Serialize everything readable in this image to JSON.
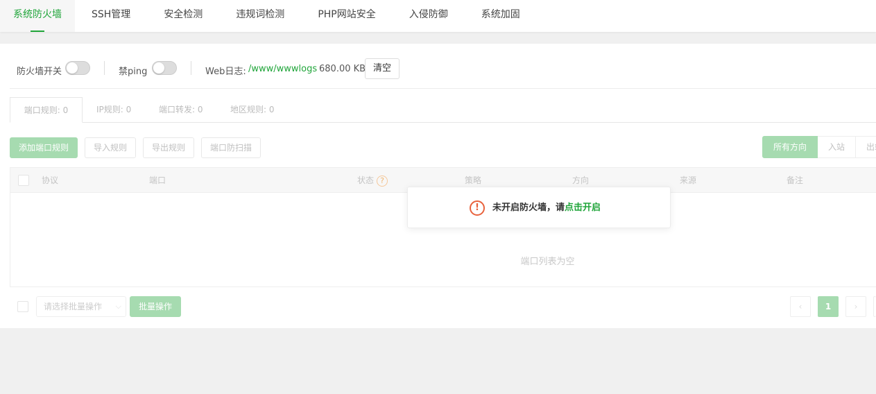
{
  "nav": {
    "tabs": [
      {
        "label": "系统防火墙"
      },
      {
        "label": "SSH管理"
      },
      {
        "label": "安全检测"
      },
      {
        "label": "违规词检测"
      },
      {
        "label": "PHP网站安全"
      },
      {
        "label": "入侵防御"
      },
      {
        "label": "系统加固"
      }
    ]
  },
  "toolbar": {
    "firewall_label": "防火墙开关",
    "ping_label": "禁ping",
    "weblog_label": "Web日志:",
    "weblog_path": "/www/wwwlogs",
    "weblog_size": "680.00 KB",
    "clear_label": "清空"
  },
  "subtabs": [
    {
      "label": "端口规则: 0"
    },
    {
      "label": "IP规则: 0"
    },
    {
      "label": "端口转发: 0"
    },
    {
      "label": "地区规则: 0"
    }
  ],
  "buttons": {
    "add_port_rule": "添加端口规则",
    "import_rules": "导入规则",
    "export_rules": "导出规则",
    "port_scan_protect": "端口防扫描"
  },
  "direction_filter": {
    "all": "所有方向",
    "inbound": "入站",
    "outbound": "出站"
  },
  "table": {
    "columns": {
      "protocol": "协议",
      "port": "端口",
      "status": "状态",
      "strategy": "策略",
      "direction": "方向",
      "source": "来源",
      "remark": "备注"
    },
    "empty_text": "端口列表为空"
  },
  "bottom": {
    "batch_select_placeholder": "请选择批量操作",
    "batch_button": "批量操作",
    "prev": "‹",
    "current_page": "1",
    "next": "›"
  },
  "toast": {
    "icon": "exclamation-circle-icon",
    "message": "未开启防火墙，请",
    "link": "点击开启"
  },
  "colors": {
    "accent": "#20a53a",
    "accent_light": "#a6dbb0",
    "warning": "#e8623c"
  }
}
